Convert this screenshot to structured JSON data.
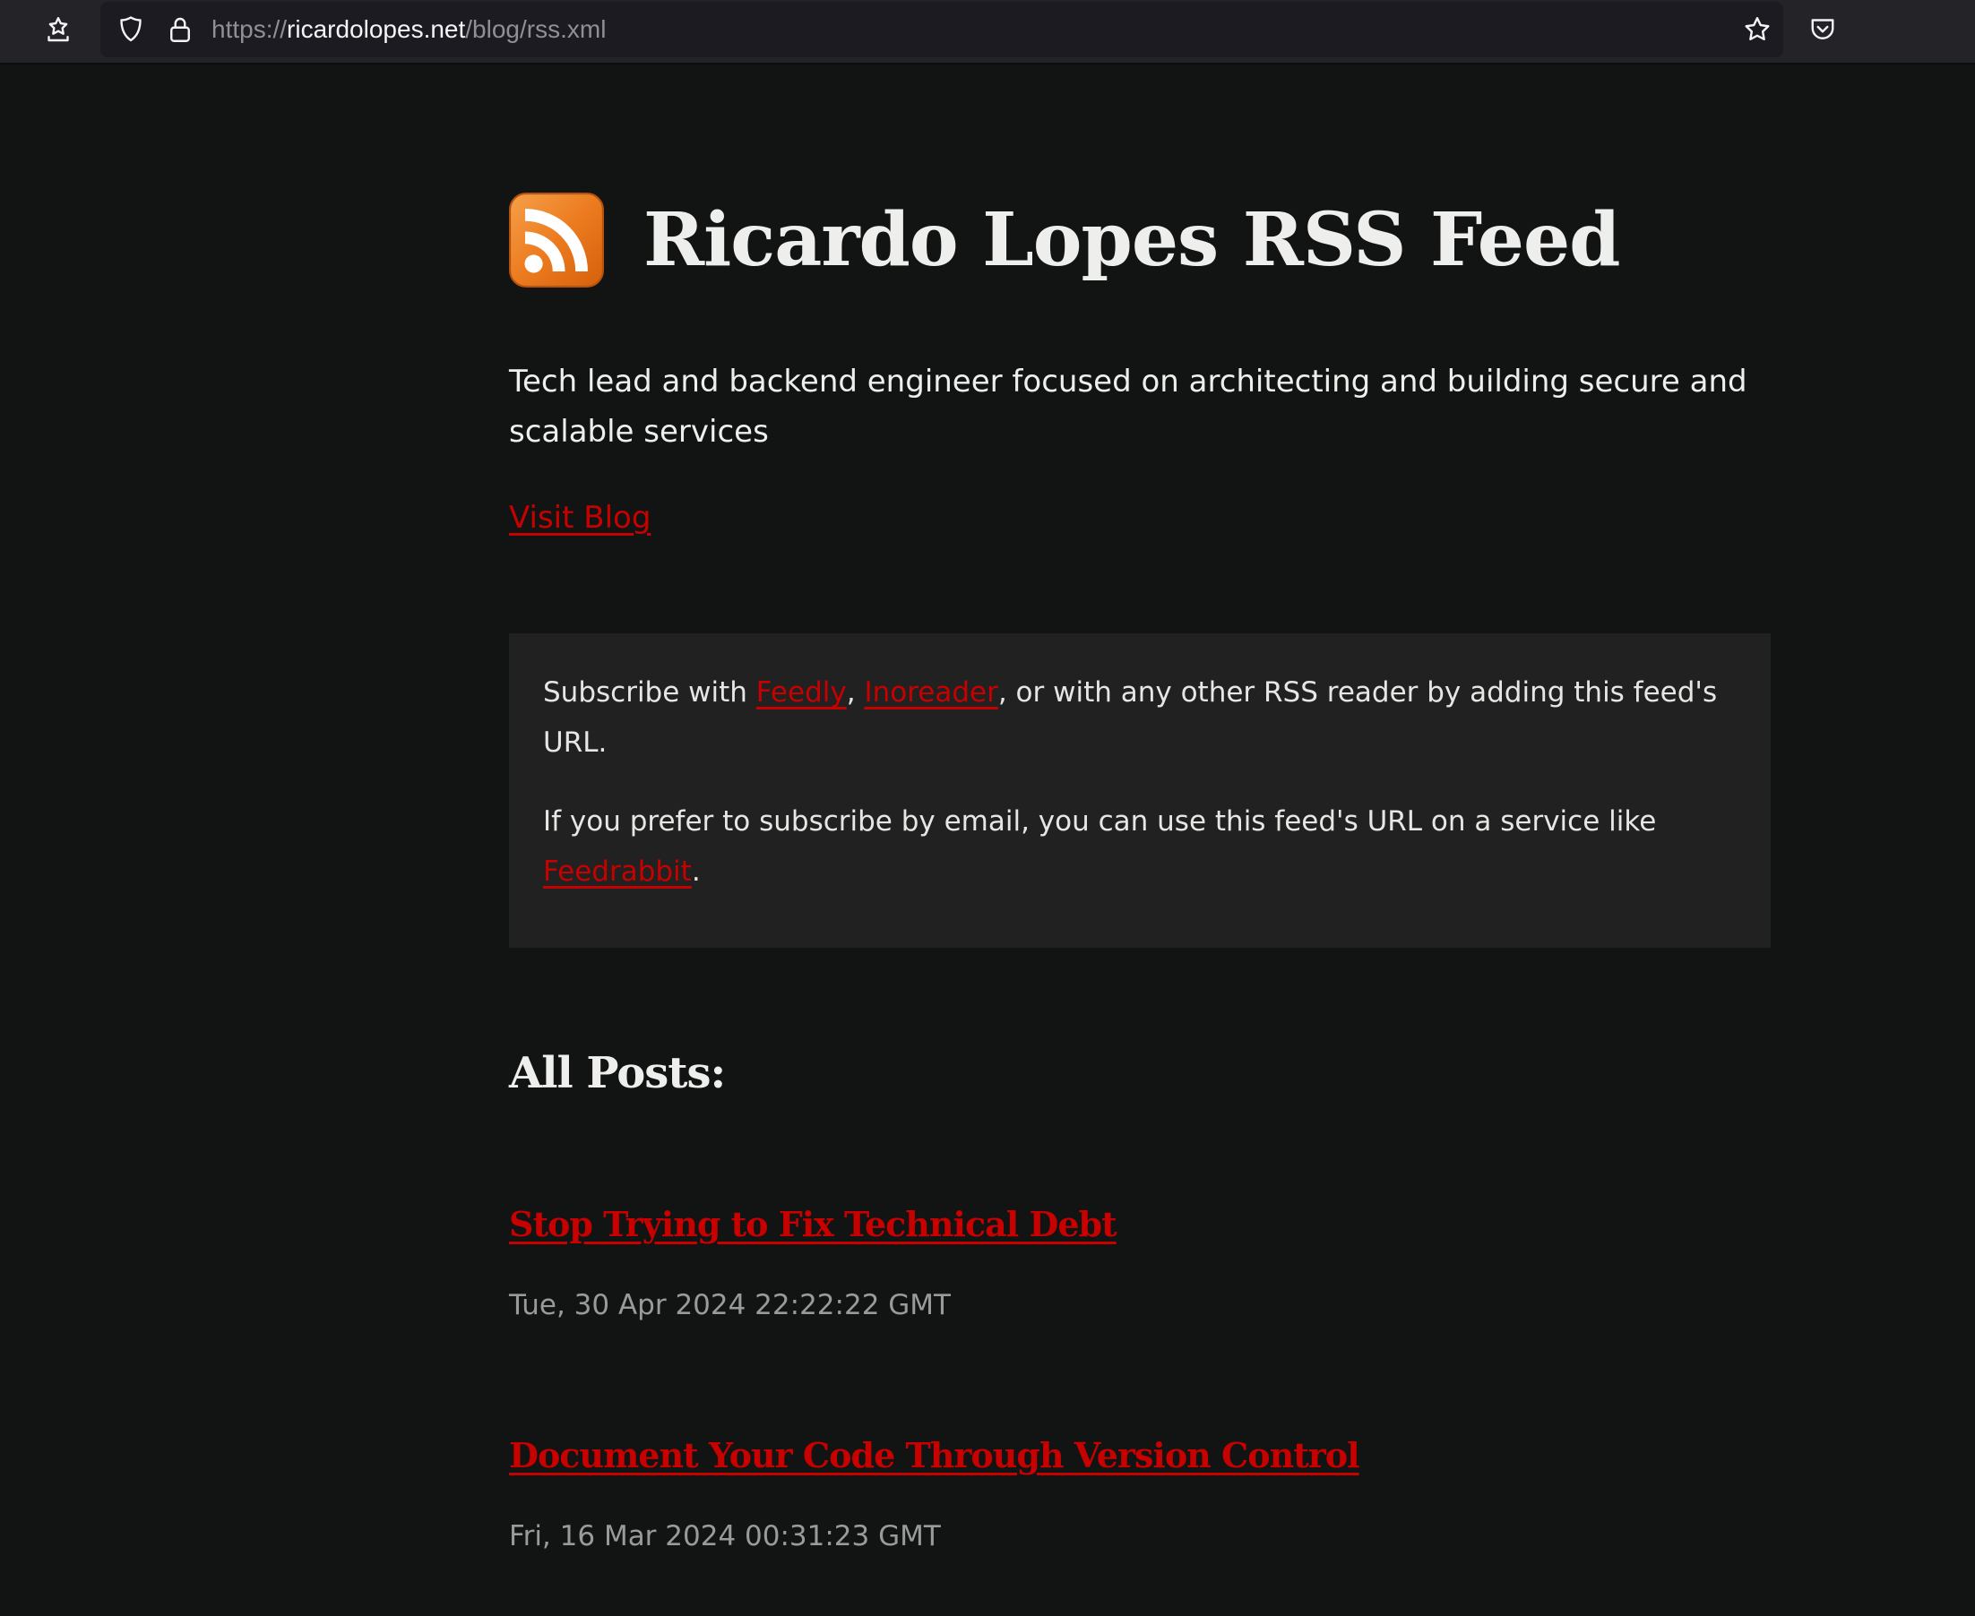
{
  "browser": {
    "url_scheme": "https://",
    "url_host": "ricardolopes.net",
    "url_path": "/blog/rss.xml",
    "icons": {
      "left": "bookmarks-sidebar-icon",
      "shield": "tracking-protection-shield-icon",
      "lock": "lock-icon",
      "star": "bookmark-star-icon",
      "pocket": "pocket-icon"
    }
  },
  "colors": {
    "background": "#121413",
    "box_background": "#202120",
    "link": "#c70000",
    "text": "#eeeeec",
    "muted": "#9a9a98",
    "rss_orange": "#f08a24"
  },
  "header": {
    "icon": "rss-feed-icon",
    "title": "Ricardo Lopes RSS Feed"
  },
  "description": "Tech lead and backend engineer focused on architecting and building secure and scalable services",
  "visit_blog_label": "Visit Blog",
  "subscribe": {
    "line1_prefix": "Subscribe with ",
    "feedly_label": "Feedly",
    "separator": ", ",
    "inoreader_label": "Inoreader",
    "line1_suffix": ", or with any other RSS reader by adding this feed's URL.",
    "line2_prefix": "If you prefer to subscribe by email, you can use this feed's URL on a service like ",
    "feedrabbit_label": "Feedrabbit",
    "line2_suffix": "."
  },
  "posts_heading": "All Posts:",
  "posts": [
    {
      "title": "Stop Trying to Fix Technical Debt",
      "date": "Tue, 30 Apr 2024 22:22:22 GMT"
    },
    {
      "title": "Document Your Code Through Version Control",
      "date": "Fri, 16 Mar 2024 00:31:23 GMT"
    }
  ]
}
